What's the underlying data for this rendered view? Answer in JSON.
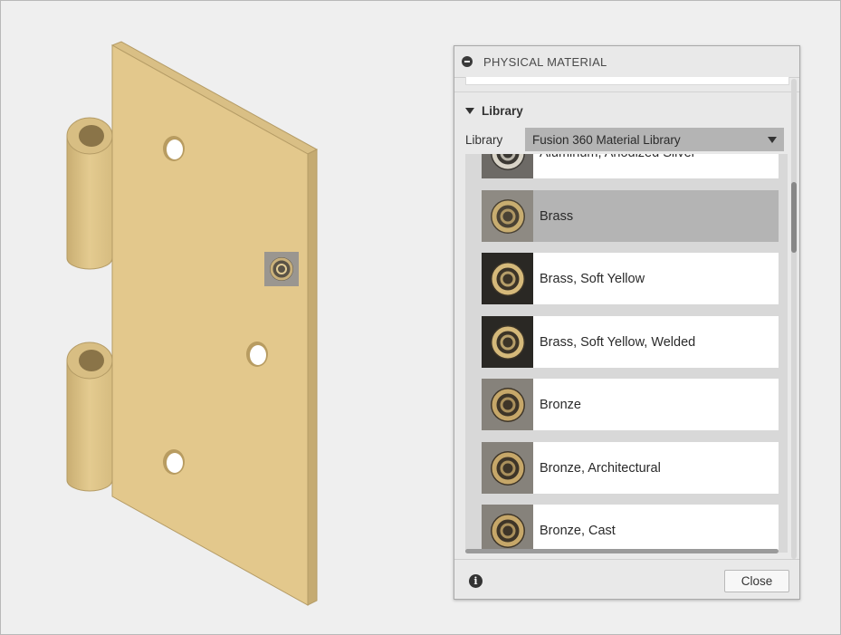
{
  "panel": {
    "title": "PHYSICAL MATERIAL",
    "section_label": "Library",
    "library_label": "Library",
    "library_value": "Fusion 360 Material Library",
    "close_label": "Close",
    "info_glyph": "i"
  },
  "materials": [
    {
      "label": "Aluminum, Anodized Silver",
      "selected": false,
      "thumb": "silver"
    },
    {
      "label": "Brass",
      "selected": true,
      "thumb": "brass-gray"
    },
    {
      "label": "Brass, Soft Yellow",
      "selected": false,
      "thumb": "brass-dark"
    },
    {
      "label": "Brass, Soft Yellow, Welded",
      "selected": false,
      "thumb": "brass-dark"
    },
    {
      "label": "Bronze",
      "selected": false,
      "thumb": "bronze-gray"
    },
    {
      "label": "Bronze, Architectural",
      "selected": false,
      "thumb": "bronze-gray"
    },
    {
      "label": "Bronze, Cast",
      "selected": false,
      "thumb": "bronze-gray"
    }
  ],
  "colors": {
    "plate_face": "#e3c88c",
    "plate_edge": "#cbb27a",
    "selected_row": "#b4b4b4"
  }
}
